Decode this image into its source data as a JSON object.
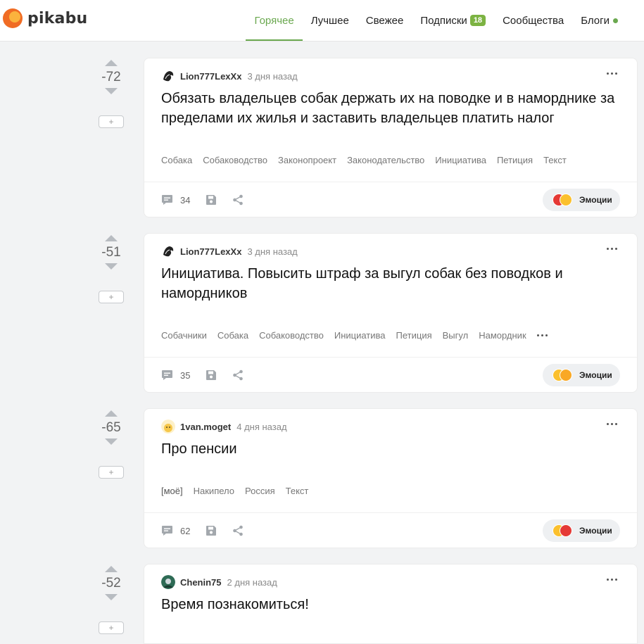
{
  "header": {
    "logo_text": "pikabu",
    "nav": [
      {
        "label": "Горячее"
      },
      {
        "label": "Лучшее"
      },
      {
        "label": "Свежее"
      },
      {
        "label": "Подписки",
        "badge": "18"
      },
      {
        "label": "Сообщества"
      },
      {
        "label": "Блоги"
      }
    ]
  },
  "colors": {
    "accent": "#6aa84f",
    "logo_orange": "#f06c24",
    "logo_yellow": "#fbb33d"
  },
  "posts": [
    {
      "score": "-72",
      "plus": "+",
      "author": "Lion777LexXx",
      "time": "3 дня назад",
      "title": "Обязать владельцев собак держать их на поводке и в наморднике за пределами их жилья и заставить владельцев платить налог",
      "tags": [
        "Собака",
        "Собаководство",
        "Законопроект",
        "Законодательство",
        "Инициатива",
        "Петиция",
        "Текст"
      ],
      "comments": "34",
      "emotions_label": "Эмоции"
    },
    {
      "score": "-51",
      "plus": "+",
      "author": "Lion777LexXx",
      "time": "3 дня назад",
      "title": "Инициатива. Повысить штраф за выгул собак без поводков и намордников",
      "tags": [
        "Собачники",
        "Собака",
        "Собаководство",
        "Инициатива",
        "Петиция",
        "Выгул",
        "Намордник"
      ],
      "comments": "35",
      "emotions_label": "Эмоции"
    },
    {
      "score": "-65",
      "plus": "+",
      "author": "1van.moget",
      "time": "4 дня назад",
      "title": "Про пенсии",
      "tags": [
        "[моё]",
        "Накипело",
        "Россия",
        "Текст"
      ],
      "comments": "62",
      "emotions_label": "Эмоции"
    },
    {
      "score": "-52",
      "plus": "+",
      "author": "Chenin75",
      "time": "2 дня назад",
      "title": "Время познакомиться!"
    }
  ]
}
